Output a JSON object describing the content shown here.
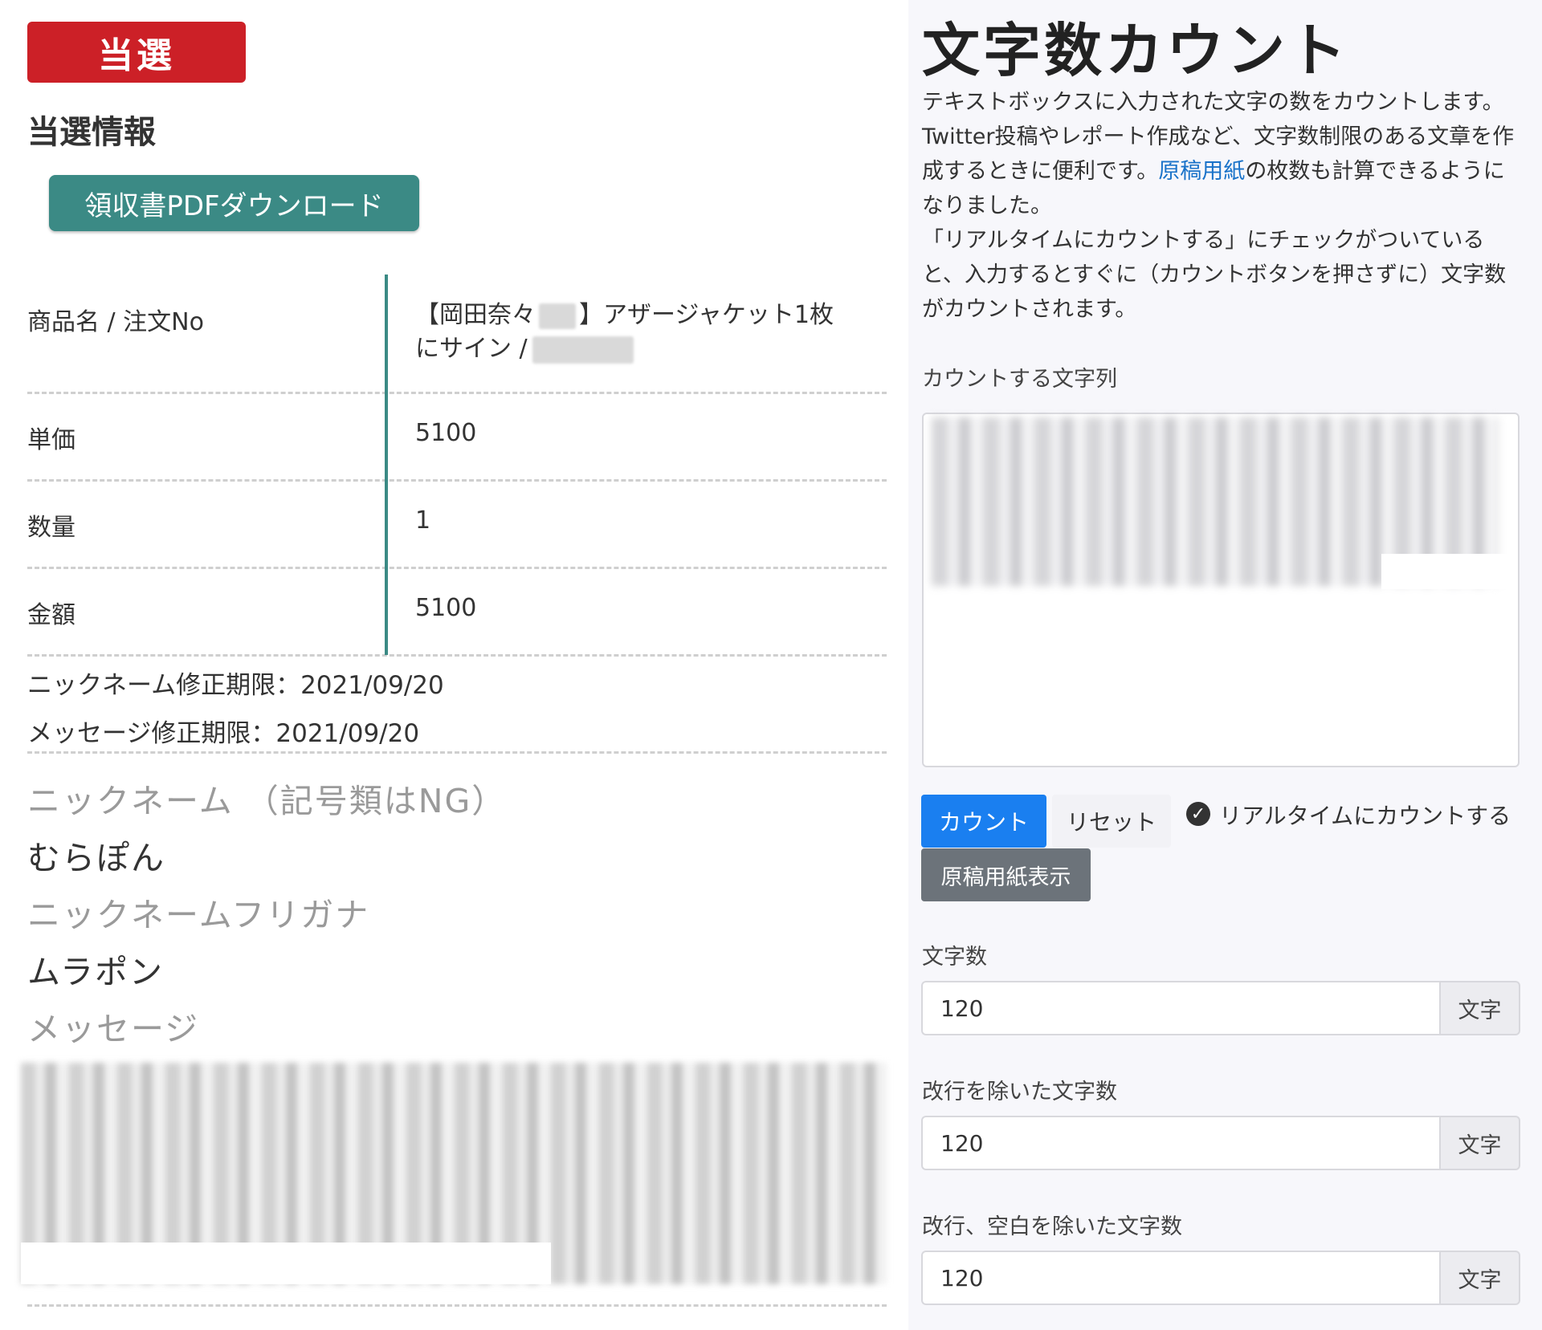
{
  "left": {
    "badge": "当選",
    "section_title": "当選情報",
    "receipt_button": "領収書PDFダウンロード",
    "rows": [
      {
        "label": "商品名 / 注文No",
        "value_line1": "【岡田奈々",
        "value_line1_b": "】アザージャケット1枚",
        "value_line2": "にサイン /"
      },
      {
        "label": "単価",
        "value": "5100"
      },
      {
        "label": "数量",
        "value": "1"
      },
      {
        "label": "金額",
        "value": "5100"
      }
    ],
    "nickname_deadline": "ニックネーム修正期限：2021/09/20",
    "message_deadline": "メッセージ修正期限：2021/09/20",
    "nickname_label": "ニックネーム （記号類はNG）",
    "nickname_value": "むらぽん",
    "furigana_label": "ニックネームフリガナ",
    "furigana_value": "ムラポン",
    "message_label": "メッセージ"
  },
  "right": {
    "title": "文字数カウント",
    "desc_part1": "テキストボックスに入力された文字の数をカウントします。Twitter投稿やレポート作成など、文字数制限のある文章を作成するときに便利です。",
    "desc_link": "原稿用紙",
    "desc_part2": "の枚数も計算できるようになりました。",
    "desc_part3": "「リアルタイムにカウントする」にチェックがついていると、入力するとすぐに（カウントボタンを押さずに）文字数がカウントされます。",
    "textarea_label": "カウントする文字列",
    "count_button": "カウント",
    "reset_button": "リセット",
    "realtime_label": "リアルタイムにカウントする",
    "realtime_checked": true,
    "genko_button": "原稿用紙表示",
    "results": [
      {
        "label": "文字数",
        "value": "120",
        "unit": "文字"
      },
      {
        "label": "改行を除いた文字数",
        "value": "120",
        "unit": "文字"
      },
      {
        "label": "改行、空白を除いた文字数",
        "value": "120",
        "unit": "文字"
      }
    ]
  },
  "colors": {
    "badge_red": "#cc2027",
    "teal": "#3b8a85",
    "primary_blue": "#1a7ff0",
    "secondary_gray": "#6c737a",
    "link_blue": "#1a73c9"
  }
}
